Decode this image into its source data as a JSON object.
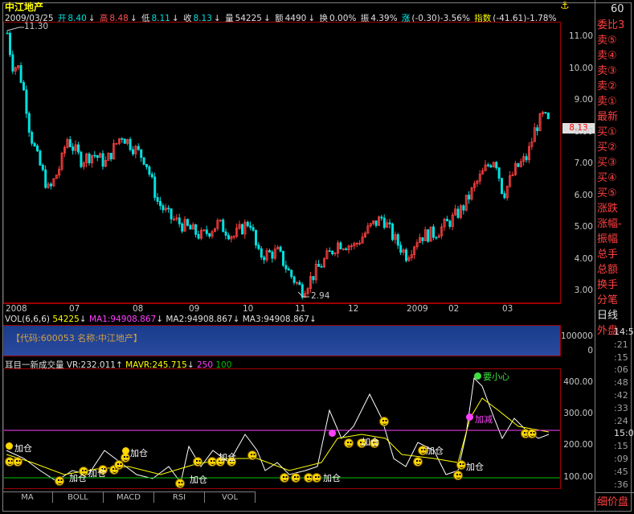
{
  "header": {
    "stock_name": "中江地产",
    "date": "2009/03/25",
    "open_label": "开",
    "open_value": "8.40",
    "open_arrow": "↓",
    "high_label": "高",
    "high_value": "8.48",
    "high_arrow": "↓",
    "low_label": "低",
    "low_value": "8.11",
    "low_arrow": "↓",
    "close_label": "收",
    "close_value": "8.13",
    "close_arrow": "↓",
    "volume_label": "量",
    "volume_value": "54225",
    "volume_arrow": "↓",
    "amount_label": "额",
    "amount_value": "4490",
    "amount_arrow": "↓",
    "turnover_label": "换",
    "turnover_value": "0.00%",
    "amplitude_label": "振",
    "amplitude_value": "4.39%",
    "change_label": "涨",
    "change_value": "(-0.30)-3.56%",
    "index_label": "指数",
    "index_value": "(-41.61)-1.78%"
  },
  "price_chart": {
    "high_marker": "11.30",
    "low_marker": "2.94",
    "current_tag": "8.13",
    "y_ticks": [
      "11.00",
      "10.00",
      "9.00",
      "8.00",
      "7.00",
      "6.00",
      "5.00",
      "4.00",
      "3.00"
    ],
    "x_labels": [
      "2008",
      "07",
      "08",
      "09",
      "10",
      "11",
      "12",
      "2009",
      "02",
      "03"
    ]
  },
  "volume_panel": {
    "title_label": "VOL(6,6,6)",
    "vol_value": "54225",
    "vol_arrow": "↓",
    "ma1_label": "MA1:94908.867",
    "ma1_arrow": "↓",
    "ma2_label": "MA2:94908.867",
    "ma2_arrow": "↓",
    "ma3_label": "MA3:94908.867",
    "ma3_arrow": "↓",
    "info_banner": "【代码:600053  名称:中江地产】",
    "y_ticks": [
      "100000",
      "0"
    ]
  },
  "indicator_panel": {
    "title": "耳目一新成交量",
    "vr_label": "VR:232.011",
    "vr_arrow": "↑",
    "mavr_label": "MAVR:245.715",
    "mavr_arrow": "↓",
    "level_250": "250",
    "level_100": "100",
    "y_ticks": [
      "400.00",
      "300.00",
      "200.00",
      "100.00"
    ],
    "annotations": {
      "add": "加仓",
      "careful": "要小心",
      "reduce": "加减"
    }
  },
  "tabs": [
    "MA",
    "BOLL",
    "MACD",
    "RSI",
    "VOL"
  ],
  "right_panel": {
    "top_number": "60",
    "items": [
      "委比3",
      "卖⑤",
      "卖④",
      "卖③",
      "卖②",
      "卖①",
      "最新",
      "买①",
      "买②",
      "买③",
      "买④",
      "买⑤",
      "涨跌",
      "涨幅-",
      "振幅",
      "总手",
      "总额",
      "换手",
      "分笔",
      "日线",
      "外盘"
    ],
    "right_numbers": [
      "14:59",
      ":21",
      ":15",
      ":06",
      ":48",
      ":42",
      ":33",
      ":24",
      "15:00",
      ":15",
      ":09",
      ":45",
      ":36"
    ],
    "bottom": "细价盘"
  },
  "colors": {
    "rise": "#ff4040",
    "fall": "#00e0e0",
    "panel_border": "#a00000",
    "text_yellow": "#ffff00",
    "line_white": "#ffffff",
    "line_yellow": "#ffff00",
    "line_magenta": "#ff40ff",
    "line_green": "#00c000"
  }
}
